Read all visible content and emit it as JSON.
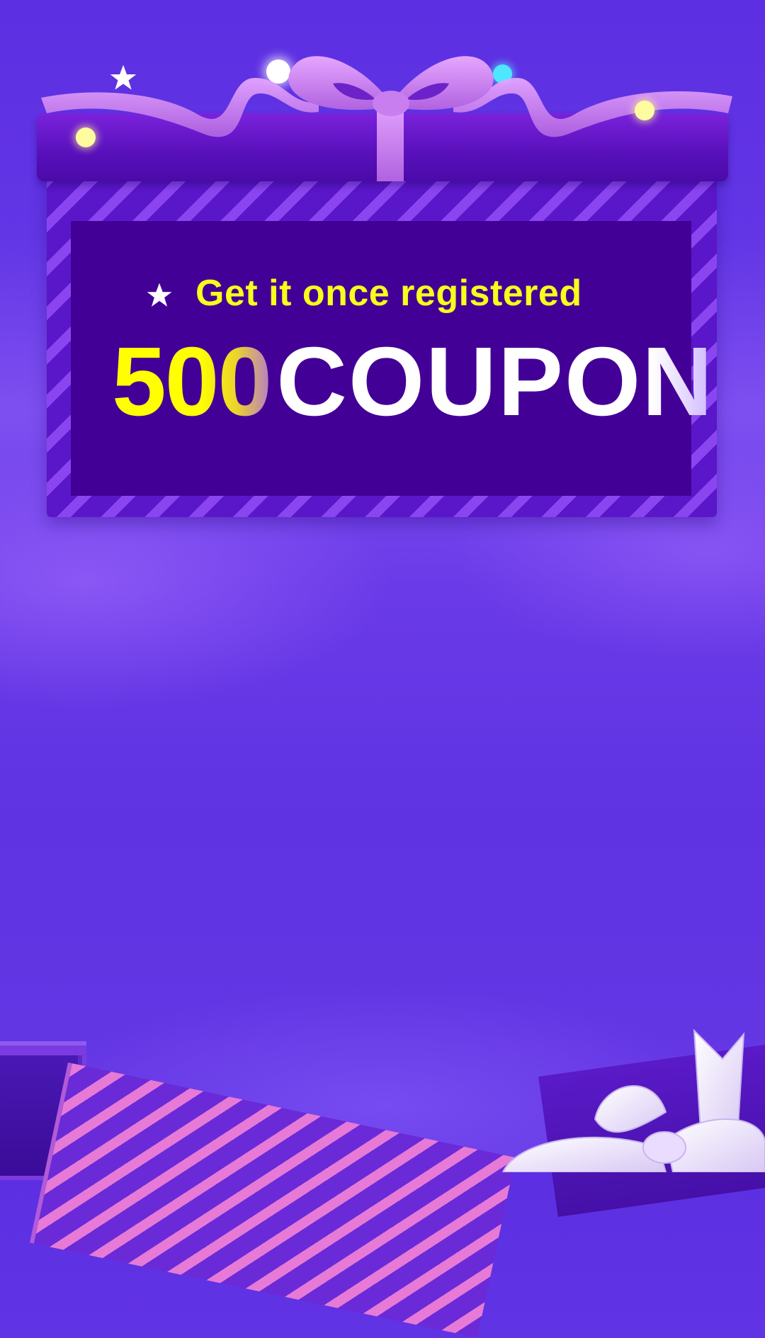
{
  "promo": {
    "tagline": "Get it once registered",
    "amount": "500",
    "word": "COUPON"
  },
  "colors": {
    "background": "#6235e5",
    "card_inner": "#430096",
    "tagline": "#f7ff1a",
    "amount": "#ffff00",
    "ribbon": "#d98bf0"
  },
  "icons": [
    "star-icon",
    "star-deco-icon",
    "ribbon-bow-icon",
    "gift-bow-icon"
  ]
}
